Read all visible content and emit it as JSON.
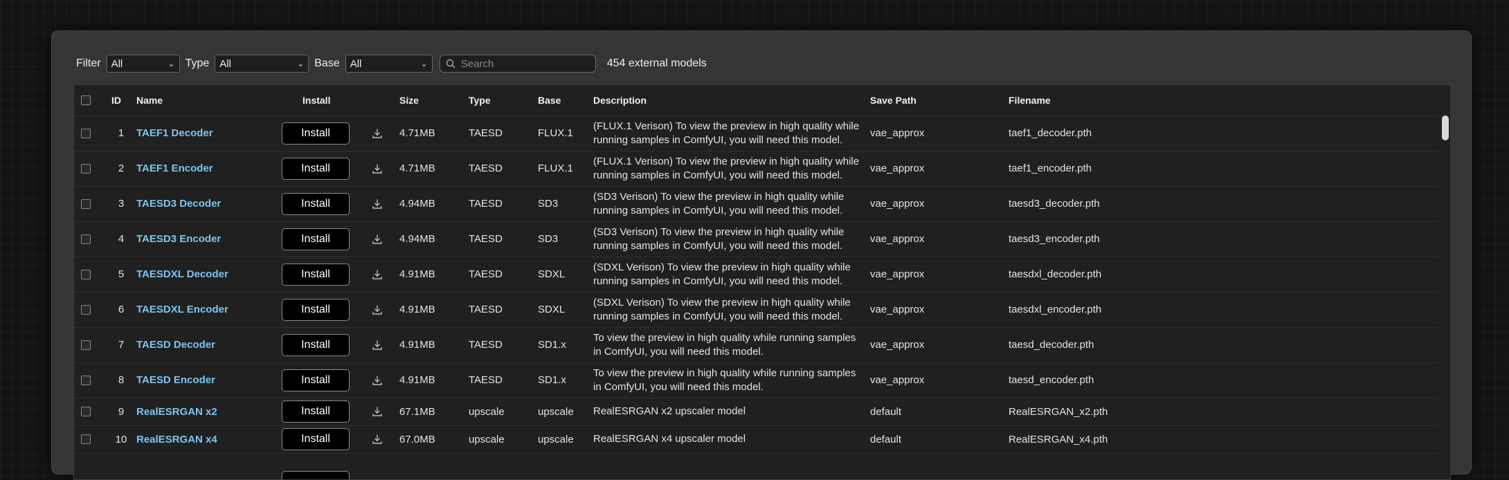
{
  "toolbar": {
    "filter_label": "Filter",
    "filter_value": "All",
    "type_label": "Type",
    "type_value": "All",
    "base_label": "Base",
    "base_value": "All",
    "search_placeholder": "Search",
    "count_text": "454 external models"
  },
  "table": {
    "headers": {
      "id": "ID",
      "name": "Name",
      "install": "Install",
      "size": "Size",
      "type": "Type",
      "base": "Base",
      "description": "Description",
      "save_path": "Save Path",
      "filename": "Filename"
    },
    "install_label": "Install",
    "rows": [
      {
        "id": "1",
        "name": "TAEF1 Decoder",
        "size": "4.71MB",
        "type": "TAESD",
        "base": "FLUX.1",
        "description": "(FLUX.1 Verison) To view the preview in high quality while running samples in ComfyUI, you will need this model.",
        "save_path": "vae_approx",
        "filename": "taef1_decoder.pth"
      },
      {
        "id": "2",
        "name": "TAEF1 Encoder",
        "size": "4.71MB",
        "type": "TAESD",
        "base": "FLUX.1",
        "description": "(FLUX.1 Verison) To view the preview in high quality while running samples in ComfyUI, you will need this model.",
        "save_path": "vae_approx",
        "filename": "taef1_encoder.pth"
      },
      {
        "id": "3",
        "name": "TAESD3 Decoder",
        "size": "4.94MB",
        "type": "TAESD",
        "base": "SD3",
        "description": "(SD3 Verison) To view the preview in high quality while running samples in ComfyUI, you will need this model.",
        "save_path": "vae_approx",
        "filename": "taesd3_decoder.pth"
      },
      {
        "id": "4",
        "name": "TAESD3 Encoder",
        "size": "4.94MB",
        "type": "TAESD",
        "base": "SD3",
        "description": "(SD3 Verison) To view the preview in high quality while running samples in ComfyUI, you will need this model.",
        "save_path": "vae_approx",
        "filename": "taesd3_encoder.pth"
      },
      {
        "id": "5",
        "name": "TAESDXL Decoder",
        "size": "4.91MB",
        "type": "TAESD",
        "base": "SDXL",
        "description": "(SDXL Verison) To view the preview in high quality while running samples in ComfyUI, you will need this model.",
        "save_path": "vae_approx",
        "filename": "taesdxl_decoder.pth"
      },
      {
        "id": "6",
        "name": "TAESDXL Encoder",
        "size": "4.91MB",
        "type": "TAESD",
        "base": "SDXL",
        "description": "(SDXL Verison) To view the preview in high quality while running samples in ComfyUI, you will need this model.",
        "save_path": "vae_approx",
        "filename": "taesdxl_encoder.pth"
      },
      {
        "id": "7",
        "name": "TAESD Decoder",
        "size": "4.91MB",
        "type": "TAESD",
        "base": "SD1.x",
        "description": "To view the preview in high quality while running samples in ComfyUI, you will need this model.",
        "save_path": "vae_approx",
        "filename": "taesd_decoder.pth"
      },
      {
        "id": "8",
        "name": "TAESD Encoder",
        "size": "4.91MB",
        "type": "TAESD",
        "base": "SD1.x",
        "description": "To view the preview in high quality while running samples in ComfyUI, you will need this model.",
        "save_path": "vae_approx",
        "filename": "taesd_encoder.pth"
      },
      {
        "id": "9",
        "name": "RealESRGAN x2",
        "size": "67.1MB",
        "type": "upscale",
        "base": "upscale",
        "description": "RealESRGAN x2 upscaler model",
        "save_path": "default",
        "filename": "RealESRGAN_x2.pth"
      },
      {
        "id": "10",
        "name": "RealESRGAN x4",
        "size": "67.0MB",
        "type": "upscale",
        "base": "upscale",
        "description": "RealESRGAN x4 upscaler model",
        "save_path": "default",
        "filename": "RealESRGAN_x4.pth"
      }
    ]
  }
}
